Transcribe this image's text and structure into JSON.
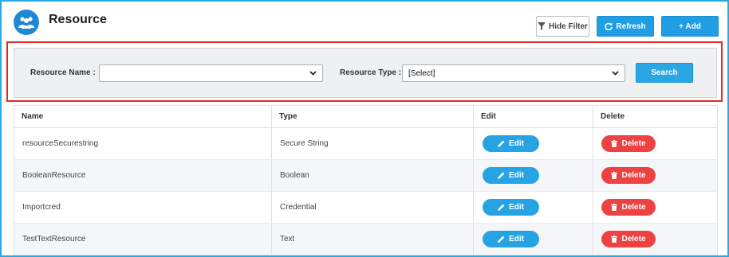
{
  "header": {
    "title": "Resource",
    "logo_icon": "people-group-icon"
  },
  "toolbar": {
    "hide_filter_label": "Hide Filter",
    "refresh_label": "Refresh",
    "add_label": "+ Add"
  },
  "filter": {
    "resource_name_label": "Resource Name :",
    "resource_name_value": "",
    "resource_type_label": "Resource Type :",
    "resource_type_value": "[Select]",
    "search_label": "Search"
  },
  "table": {
    "columns": [
      "Name",
      "Type",
      "Edit",
      "Delete"
    ],
    "edit_label": "Edit",
    "delete_label": "Delete",
    "rows": [
      {
        "name": "resourceSecurestring",
        "type": "Secure String"
      },
      {
        "name": "BooleanResource",
        "type": "Boolean"
      },
      {
        "name": "Importcred",
        "type": "Credential"
      },
      {
        "name": "TestTextResource",
        "type": "Text"
      }
    ]
  },
  "colors": {
    "accent": "#1f9ee3",
    "delete": "#ee4141",
    "filter_highlight": "#e02a2a",
    "frame": "#29abe2"
  }
}
